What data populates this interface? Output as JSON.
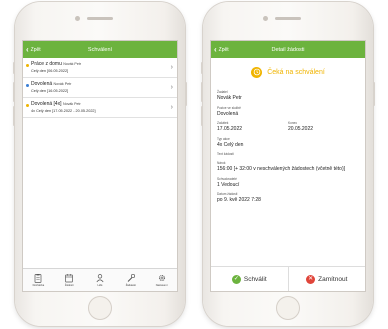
{
  "left": {
    "topbar": {
      "back_label": "Zpět",
      "title": "Schválení"
    },
    "items": [
      {
        "title": "Práce z domu",
        "user": "Novák Petr",
        "detail": "Celý den [06.05.2022]",
        "color": "#f0b400"
      },
      {
        "title": "Dovolená",
        "user": "Novák Petr",
        "detail": "Celý den [16.05.2022]",
        "color": "#3a7fd5"
      },
      {
        "title": "Dovolená [4x]",
        "user": "Novák Petr",
        "detail": "4x Celý den [17.05.2022 - 20.05.2022]",
        "color": "#f0b400"
      }
    ],
    "tabs": [
      {
        "label": "Docházka",
        "icon": "clipboard-icon"
      },
      {
        "label": "Žádosti",
        "icon": "calendar-icon"
      },
      {
        "label": "Lidé",
        "icon": "person-icon"
      },
      {
        "label": "Žádatelé",
        "icon": "wrench-icon"
      },
      {
        "label": "Nastavení",
        "icon": "gear-icon"
      }
    ]
  },
  "right": {
    "topbar": {
      "back_label": "Zpět",
      "title": "Detail žádosti"
    },
    "status": {
      "text": "Čeká na schválení",
      "color": "#f0b400"
    },
    "fields": {
      "applicant": {
        "label": "Žadatel",
        "value": "Novák Petr"
      },
      "position": {
        "label": "Pozice ve službě",
        "value": "Dovolená"
      },
      "start": {
        "label": "Začátek",
        "value": "17.05.2022"
      },
      "end": {
        "label": "Konec",
        "value": "20.05.2022"
      },
      "type": {
        "label": "Typ akce",
        "value": "4x Celý den"
      },
      "text": {
        "label": "Text žádosti",
        "value": ""
      },
      "claim": {
        "label": "Nárok",
        "value": "156:00 [+ 32:00 v neschválených žádostech (včetně této)]"
      },
      "approver": {
        "label": "Schvalovatelé",
        "value": "1 Vedoucí"
      },
      "date": {
        "label": "Datum žádosti",
        "value": "po 9. kvě 2022 7:28"
      }
    },
    "actions": {
      "approve": {
        "label": "Schválit",
        "color": "#6cb33e"
      },
      "reject": {
        "label": "Zamítnout",
        "color": "#e0453a"
      }
    }
  }
}
